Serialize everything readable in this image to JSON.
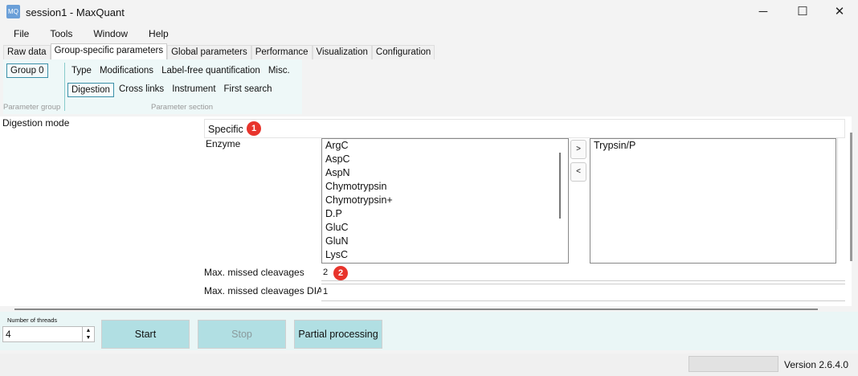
{
  "window": {
    "title": "session1 - MaxQuant",
    "icon": "maxquant-icon",
    "minimize": "─",
    "maximize": "☐",
    "close": "✕"
  },
  "menu": [
    "File",
    "Tools",
    "Window",
    "Help"
  ],
  "tabs": [
    "Raw data",
    "Group-specific parameters",
    "Global parameters",
    "Performance",
    "Visualization",
    "Configuration"
  ],
  "group": {
    "label": "Group 0",
    "caption": "Parameter group"
  },
  "sections": {
    "row1": [
      "Type",
      "Modifications",
      "Label-free quantification",
      "Misc."
    ],
    "row2": [
      "Digestion",
      "Cross links",
      "Instrument",
      "First search"
    ],
    "caption": "Parameter section"
  },
  "digestion": {
    "mode_label": "Digestion mode",
    "mode_value": "Specific",
    "enzyme_label": "Enzyme",
    "available": [
      "ArgC",
      "AspC",
      "AspN",
      "Chymotrypsin",
      "Chymotrypsin+",
      "D.P",
      "GluC",
      "GluN",
      "LysC"
    ],
    "selected": [
      "Trypsin/P"
    ],
    "add": ">",
    "remove": "<",
    "missed_label": "Max. missed cleavages",
    "missed_value": "2",
    "missed_dia_label": "Max. missed cleavages DIA",
    "missed_dia_value": "1"
  },
  "annotations": [
    "1",
    "2"
  ],
  "bottom": {
    "threads_label": "Number of threads",
    "threads_value": "4",
    "start": "Start",
    "stop": "Stop",
    "partial": "Partial processing"
  },
  "status": {
    "version": "Version 2.6.4.0"
  }
}
